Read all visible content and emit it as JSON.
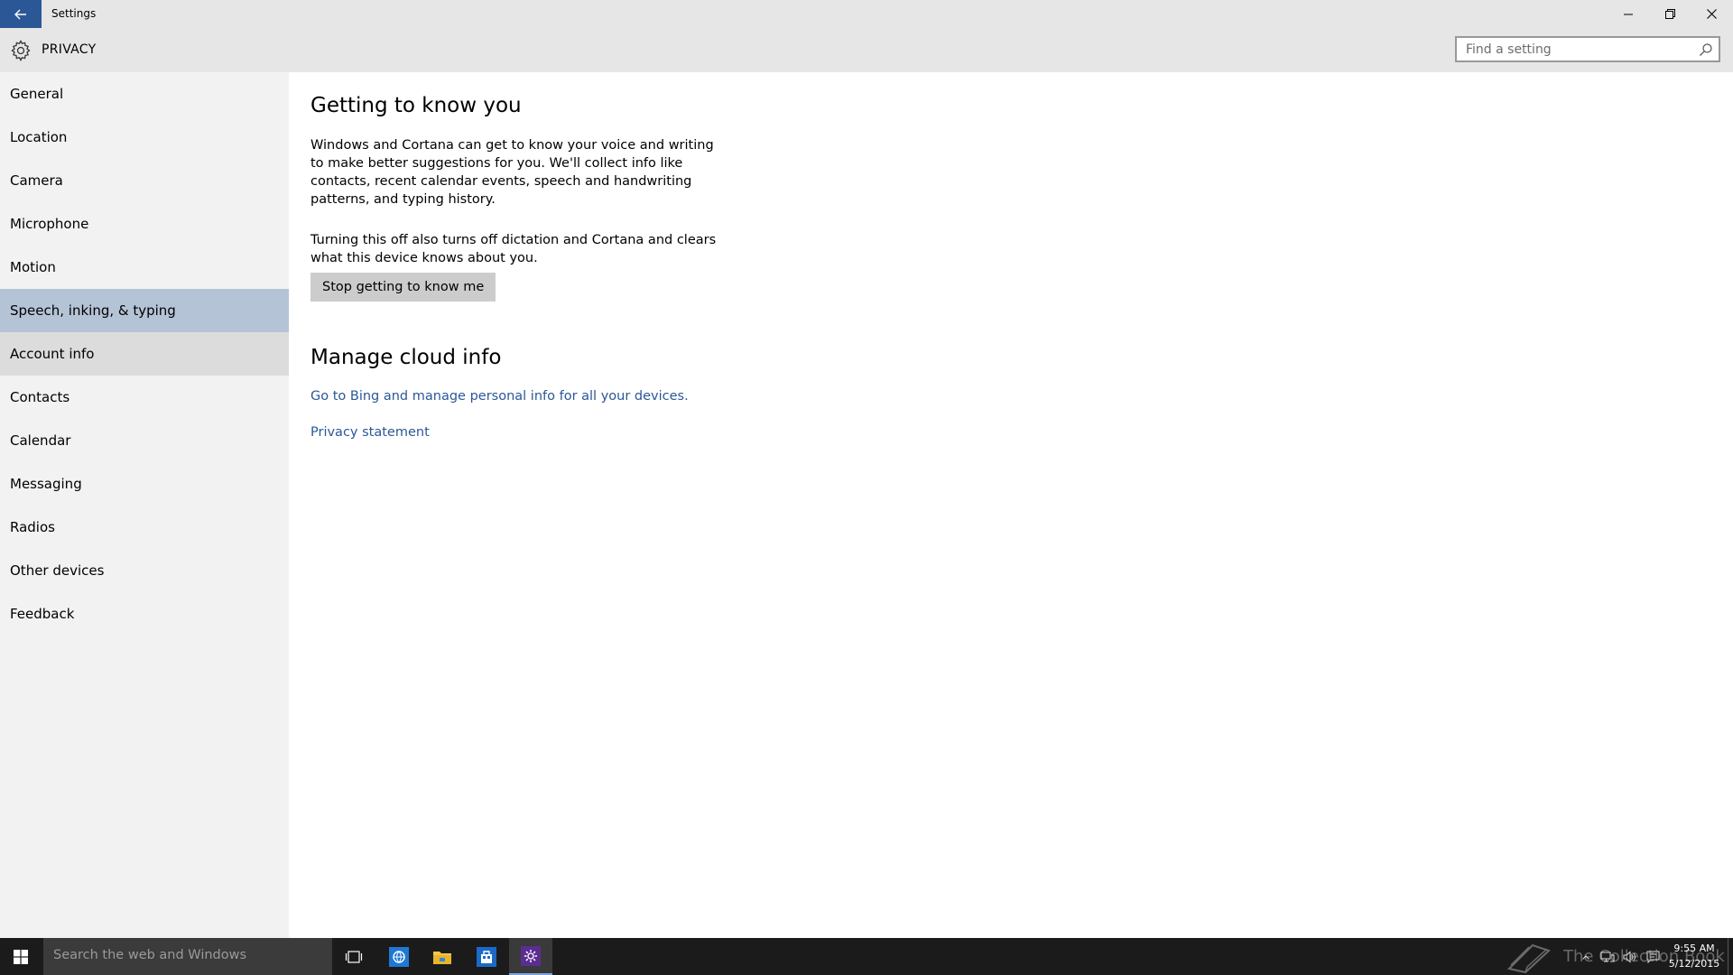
{
  "window": {
    "title": "Settings",
    "controls": {
      "minimize_icon": "minimize-icon",
      "restore_icon": "restore-icon",
      "close_icon": "close-icon"
    }
  },
  "header": {
    "title": "PRIVACY",
    "icon": "gear-icon",
    "search_placeholder": "Find a setting"
  },
  "sidebar": {
    "items": [
      {
        "label": "General"
      },
      {
        "label": "Location"
      },
      {
        "label": "Camera"
      },
      {
        "label": "Microphone"
      },
      {
        "label": "Motion"
      },
      {
        "label": "Speech, inking, & typing",
        "selected": true
      },
      {
        "label": "Account info",
        "hovered": true
      },
      {
        "label": "Contacts"
      },
      {
        "label": "Calendar"
      },
      {
        "label": "Messaging"
      },
      {
        "label": "Radios"
      },
      {
        "label": "Other devices"
      },
      {
        "label": "Feedback"
      }
    ]
  },
  "main": {
    "getting_to_know": {
      "heading": "Getting to know you",
      "description": "Windows and Cortana can get to know your voice and writing to make better suggestions for you. We'll collect info like contacts, recent calendar events, speech and handwriting patterns, and typing history.",
      "note": "Turning this off also turns off dictation and Cortana and clears what this device knows about you.",
      "button_label": "Stop getting to know me"
    },
    "cloud": {
      "heading": "Manage cloud info",
      "bing_link": "Go to Bing and manage personal info for all your devices.",
      "privacy_link": "Privacy statement"
    }
  },
  "taskbar": {
    "search_placeholder": "Search the web and Windows",
    "apps": [
      "task-view-icon",
      "internet-explorer-icon",
      "file-explorer-icon",
      "store-icon",
      "settings-app-icon"
    ],
    "watermark": "The Collection Book",
    "time": "9:55 AM",
    "date": "5/12/2015"
  },
  "colors": {
    "accent": "#2b5797",
    "selected_nav": "#b4c3d6",
    "hover_nav": "#dcdcdc",
    "sidebar_bg": "#f2f2f2",
    "chrome_bg": "#e6e6e6",
    "taskbar_bg": "#1b1b1b"
  }
}
